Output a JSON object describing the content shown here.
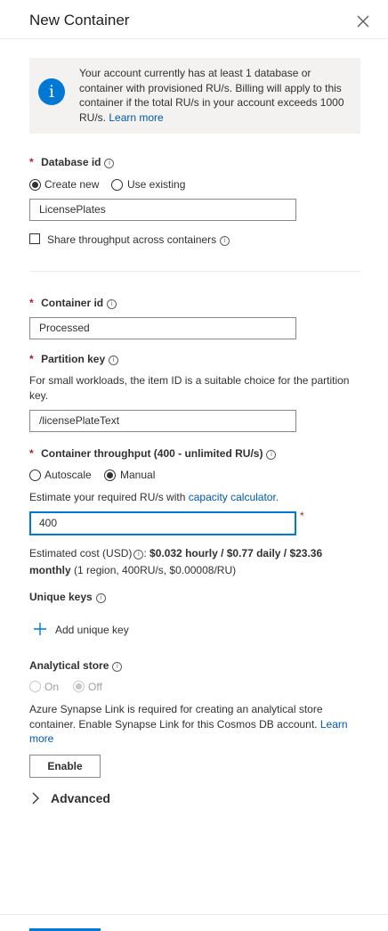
{
  "header": {
    "title": "New Container"
  },
  "info": {
    "text": "Your account currently has at least 1 database or container with provisioned RU/s. Billing will apply to this container if the total RU/s in your account exceeds 1000 RU/s.",
    "link": "Learn more"
  },
  "database": {
    "label": "Database id",
    "required_mark": "*",
    "radio_create": "Create new",
    "radio_existing": "Use existing",
    "selected": "Create new",
    "value": "LicensePlates",
    "share_label": "Share throughput across containers",
    "share_checked": false
  },
  "container": {
    "label": "Container id",
    "required_mark": "*",
    "value": "Processed"
  },
  "partition": {
    "label": "Partition key",
    "required_mark": "*",
    "help": "For small workloads, the item ID is a suitable choice for the partition key.",
    "value": "/licensePlateText"
  },
  "throughput": {
    "label": "Container throughput (400 - unlimited RU/s)",
    "required_mark": "*",
    "radio_autoscale": "Autoscale",
    "radio_manual": "Manual",
    "selected": "Manual",
    "estimate_prefix": "Estimate your required RU/s with",
    "estimate_link": "capacity calculator.",
    "value": "400",
    "cost_label": "Estimated cost (USD)",
    "cost_bold_1": "$0.032 hourly / $0.77 daily / $23.36",
    "cost_bold_2": "monthly",
    "cost_detail": "(1 region, 400RU/s, $0.00008/RU)"
  },
  "unique_keys": {
    "label": "Unique keys",
    "add_label": "Add unique key"
  },
  "analytical": {
    "label": "Analytical store",
    "radio_on": "On",
    "radio_off": "Off",
    "selected": "Off",
    "help": "Azure Synapse Link is required for creating an analytical store container. Enable Synapse Link for this Cosmos DB account.",
    "link": "Learn more",
    "enable_button": "Enable"
  },
  "advanced": {
    "label": "Advanced"
  },
  "icons": {
    "close": "close-icon",
    "info": "info-icon",
    "tooltip": "info-circle-icon",
    "add": "plus-icon",
    "chevron": "chevron-right-icon"
  },
  "colors": {
    "accent": "#0078d4",
    "link": "#0058ad",
    "required": "#a4262c"
  }
}
